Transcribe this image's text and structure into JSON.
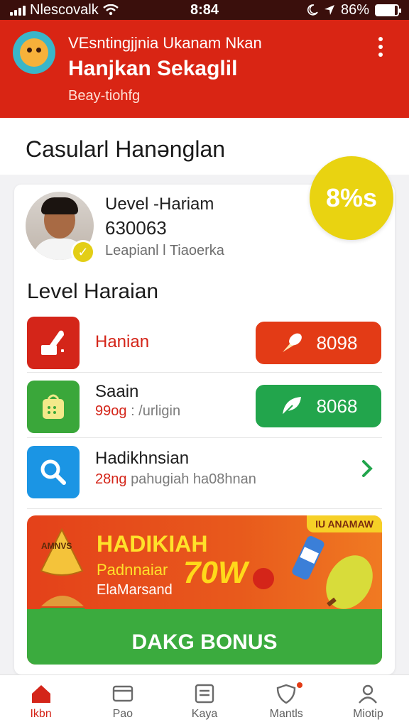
{
  "status_bar": {
    "carrier": "Nlescovalk",
    "time": "8:84",
    "battery": "86%"
  },
  "header": {
    "line1": "VEsntingjjnia Ukanam Nkan",
    "title": "Hanjkan Sekaglil",
    "subtitle": "Beay-tiohfg"
  },
  "section": {
    "title": "Casularl Hanənglan"
  },
  "profile": {
    "level": "Uevel -Hariam",
    "points": "630063",
    "description": "Leapianl l Tiaoerka",
    "percent": "8%s",
    "progress_value": 0.08
  },
  "list": {
    "title": "Level Haraian",
    "items": [
      {
        "label": "Hanian",
        "button": "8098"
      },
      {
        "label": "Saain",
        "meta_highlight": "99og",
        "meta": ": /urligin",
        "button": "8068"
      },
      {
        "label": "Hadikhnsian",
        "meta_highlight": "28ng",
        "meta": "pahugiah ha08hnan"
      }
    ]
  },
  "banner": {
    "tag": "IU ANAMAW",
    "title": "HADIKIAH",
    "subtitle1": "Padnnaiar",
    "subtitle2": "ElaMarsand",
    "pow": "70W",
    "cone_text": "AMNVS",
    "button": "DAKG BONUS"
  },
  "nav": [
    {
      "label": "Ikbn",
      "icon": "home-icon"
    },
    {
      "label": "Pao",
      "icon": "card-icon"
    },
    {
      "label": "Kaya",
      "icon": "list-icon"
    },
    {
      "label": "Mantls",
      "icon": "shield-icon"
    },
    {
      "label": "Miotip",
      "icon": "profile-icon"
    }
  ],
  "colors": {
    "brand_red": "#d92514",
    "accent_yellow": "#e9d311",
    "green": "#22a54c",
    "blue": "#1b95e4"
  }
}
